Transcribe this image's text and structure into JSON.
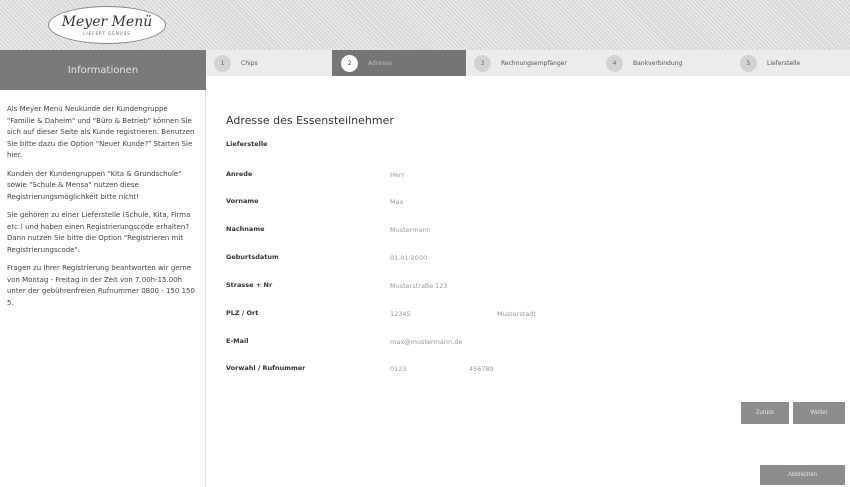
{
  "header": {
    "logo_main": "Meyer Menü",
    "logo_sub": "LIEFERT GENUSS"
  },
  "sidebar": {
    "title": "Informationen",
    "paragraphs": [
      "Als Meyer Menü Neukunde der Kundengruppe \"Familie & Daheim\" und \"Büro & Betrieb\" können Sie sich auf dieser Seite als Kunde registrieren. Benutzen Sie bitte dazu die Option \"Neuer Kunde?\" Starten Sie hier.",
      "Kunden der Kundengruppen \"Kita & Grundschule\" sowie \"Schule & Mensa\" nutzen diese Registrierungsmöglichkeit bitte nicht!",
      "Sie gehören zu einer Lieferstelle (Schule, Kita, Firma etc.) und haben einen Registrierungscode erhalten? Dann nutzen Sie bitte die Option \"Registrieren mit Registrierungscode\".",
      "Fragen zu Ihrer Registrierung beantworten wir gerne von Montag - Freitag in der Zeit von 7.00h-15.00h unter der gebührenfreien Rufnummer 0800 - 150 150 5."
    ]
  },
  "steps": [
    {
      "num": "1",
      "label": "Chips"
    },
    {
      "num": "2",
      "label": "Adresse"
    },
    {
      "num": "3",
      "label": "Rechnungsempfänger"
    },
    {
      "num": "4",
      "label": "Bankverbindung"
    },
    {
      "num": "5",
      "label": "Lieferstelle"
    }
  ],
  "form": {
    "title": "Adresse des Essensteilnehmer",
    "fields": {
      "lieferstelle": {
        "label": "Lieferstelle"
      },
      "anrede": {
        "label": "Anrede",
        "value": "Herr"
      },
      "vorname": {
        "label": "Vorname",
        "value": "Max"
      },
      "nachname": {
        "label": "Nachname",
        "value": "Mustermann"
      },
      "geburtsdatum": {
        "label": "Geburtsdatum",
        "value": "01.01.2000"
      },
      "strasse": {
        "label": "Strasse + Nr",
        "value": "Musterstraße 123"
      },
      "plz_ort": {
        "label": "PLZ / Ort",
        "plz": "12345",
        "ort": "Musterstadt"
      },
      "email": {
        "label": "E-Mail",
        "value": "max@mustermann.de"
      },
      "telefon": {
        "label": "Vorwahl / Rufnummer",
        "vorwahl": "0123",
        "nummer": "456789"
      }
    }
  },
  "buttons": {
    "back": "Zurück",
    "next": "Weiter",
    "abort": "Abbrechen"
  },
  "colors": {
    "sidebar_head": "#7a7a7a",
    "active_step": "#757575",
    "button": "#8d8d8d"
  }
}
